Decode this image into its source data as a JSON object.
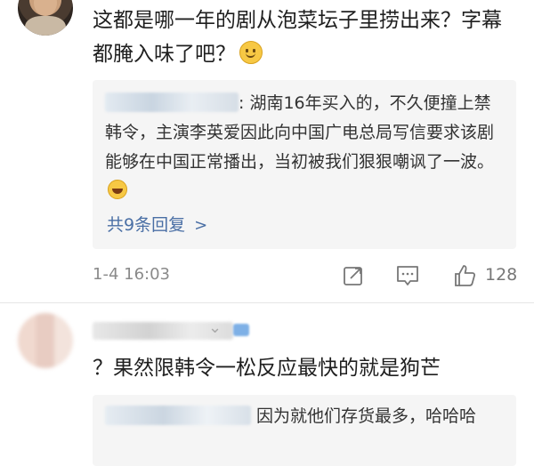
{
  "comment1": {
    "text": "这都是哪一年的剧从泡菜坛子里捞出来？字幕都腌入味了吧？",
    "emoji": "smile-emoji",
    "reply": {
      "text_prefix": ": ",
      "text": "湖南16年买入的，不久便撞上禁韩令，主演李英爱因此向中国广电总局写信要求该剧能够在中国正常播出，当初被我们狠狠嘲讽了一波。",
      "emoji": "laugh-emoji"
    },
    "more_replies": "共9条回复",
    "time": "1-4 16:03",
    "likes": "128"
  },
  "comment2": {
    "text": "？果然限韩令一松反应最快的就是狗芒",
    "reply": {
      "text": "因为就他们存货最多，哈哈哈"
    }
  },
  "colors": {
    "link": "#4a6fa5",
    "reply_bg": "#f5f5f5",
    "meta": "#8a8a8a"
  }
}
